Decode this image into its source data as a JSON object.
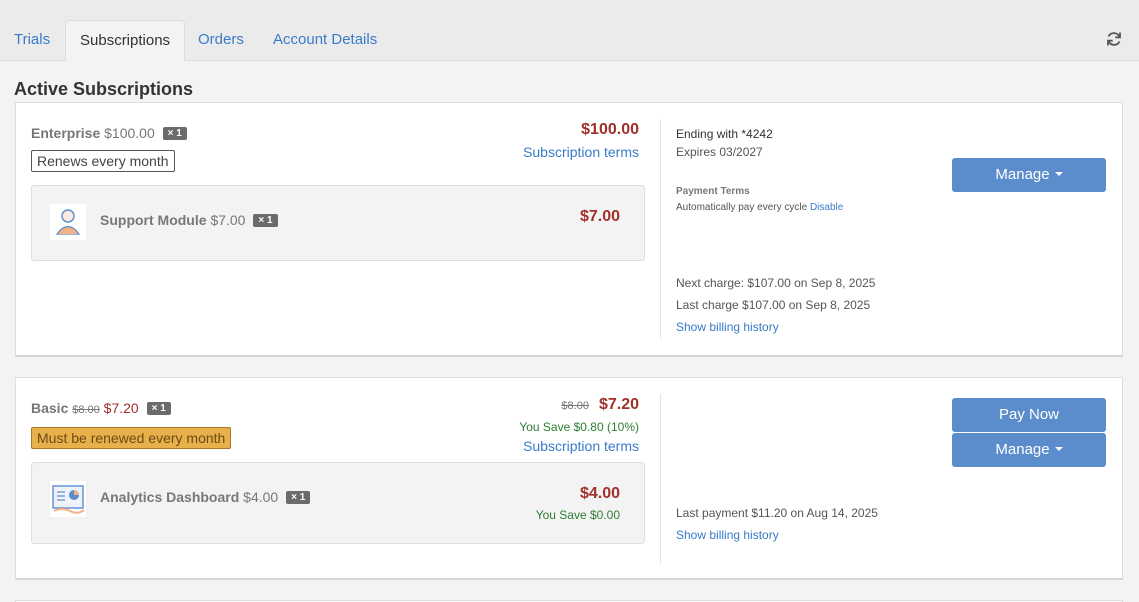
{
  "tabs": [
    {
      "label": "Trials"
    },
    {
      "label": "Subscriptions",
      "active": true
    },
    {
      "label": "Orders"
    },
    {
      "label": "Account Details"
    }
  ],
  "section_title": "Active Subscriptions",
  "colors": {
    "link": "#3a7bc8",
    "price": "#a0312a",
    "button": "#5b8ccc",
    "save": "#2e7d32",
    "warning_badge": "#e8b04a"
  },
  "subscriptions": [
    {
      "name": "Enterprise",
      "price": "$100.00",
      "qty": "× 1",
      "badge": "Renews every month",
      "total": "$100.00",
      "terms_link": "Subscription terms",
      "addon": {
        "icon": "support-person-icon",
        "name": "Support Module",
        "price": "$7.00",
        "qty": "× 1",
        "total": "$7.00"
      },
      "card_ending": "Ending with *4242",
      "expires": "Expires 03/2027",
      "payment_terms_label": "Payment Terms",
      "payment_terms_text": "Automatically pay every cycle",
      "disable_link": "Disable",
      "next_charge": "Next charge: $107.00 on Sep 8, 2025",
      "last_charge": "Last charge $107.00 on Sep 8, 2025",
      "billing_history_link": "Show billing history",
      "manage_label": "Manage"
    },
    {
      "name": "Basic",
      "original_price": "$8.00",
      "price": "$7.20",
      "qty": "× 1",
      "badge": "Must be renewed every month",
      "total_original": "$8.00",
      "total": "$7.20",
      "savings": "You Save $0.80 (10%)",
      "terms_link": "Subscription terms",
      "addon": {
        "icon": "analytics-dashboard-icon",
        "name": "Analytics Dashboard",
        "price": "$4.00",
        "qty": "× 1",
        "total": "$4.00",
        "savings": "You Save $0.00"
      },
      "last_payment": "Last payment $11.20 on Aug 14, 2025",
      "billing_history_link": "Show billing history",
      "pay_now_label": "Pay Now",
      "manage_label": "Manage"
    }
  ]
}
